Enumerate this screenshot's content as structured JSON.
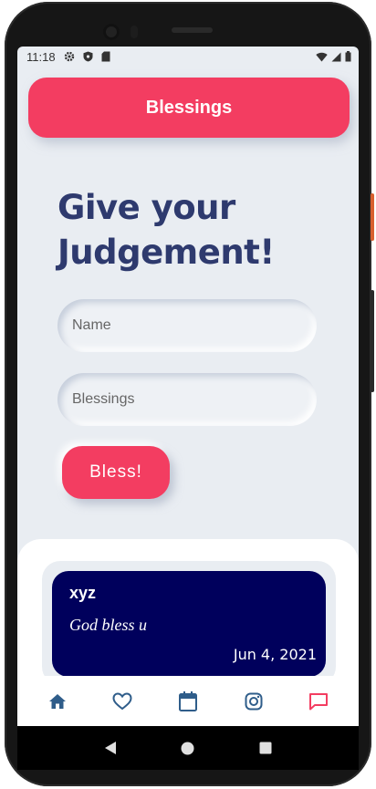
{
  "status_bar": {
    "time": "11:18"
  },
  "header": {
    "title": "Blessings"
  },
  "form": {
    "heading": "Give your Judgement!",
    "name_placeholder": "Name",
    "blessings_placeholder": "Blessings",
    "submit_label": "Bless!"
  },
  "blessings": [
    {
      "name": "xyz",
      "message": "God bless u",
      "date": "Jun 4, 2021"
    }
  ],
  "bottom_nav": [
    {
      "icon": "home-icon",
      "active": false
    },
    {
      "icon": "heart-icon",
      "active": false
    },
    {
      "icon": "calendar-icon",
      "active": false
    },
    {
      "icon": "instagram-icon",
      "active": false
    },
    {
      "icon": "chat-icon",
      "active": true
    }
  ],
  "colors": {
    "accent": "#f33d61",
    "navy_card": "#00005c",
    "heading": "#2e3a6e",
    "nav_icon": "#2f5d8a",
    "background": "#e9edf2"
  }
}
